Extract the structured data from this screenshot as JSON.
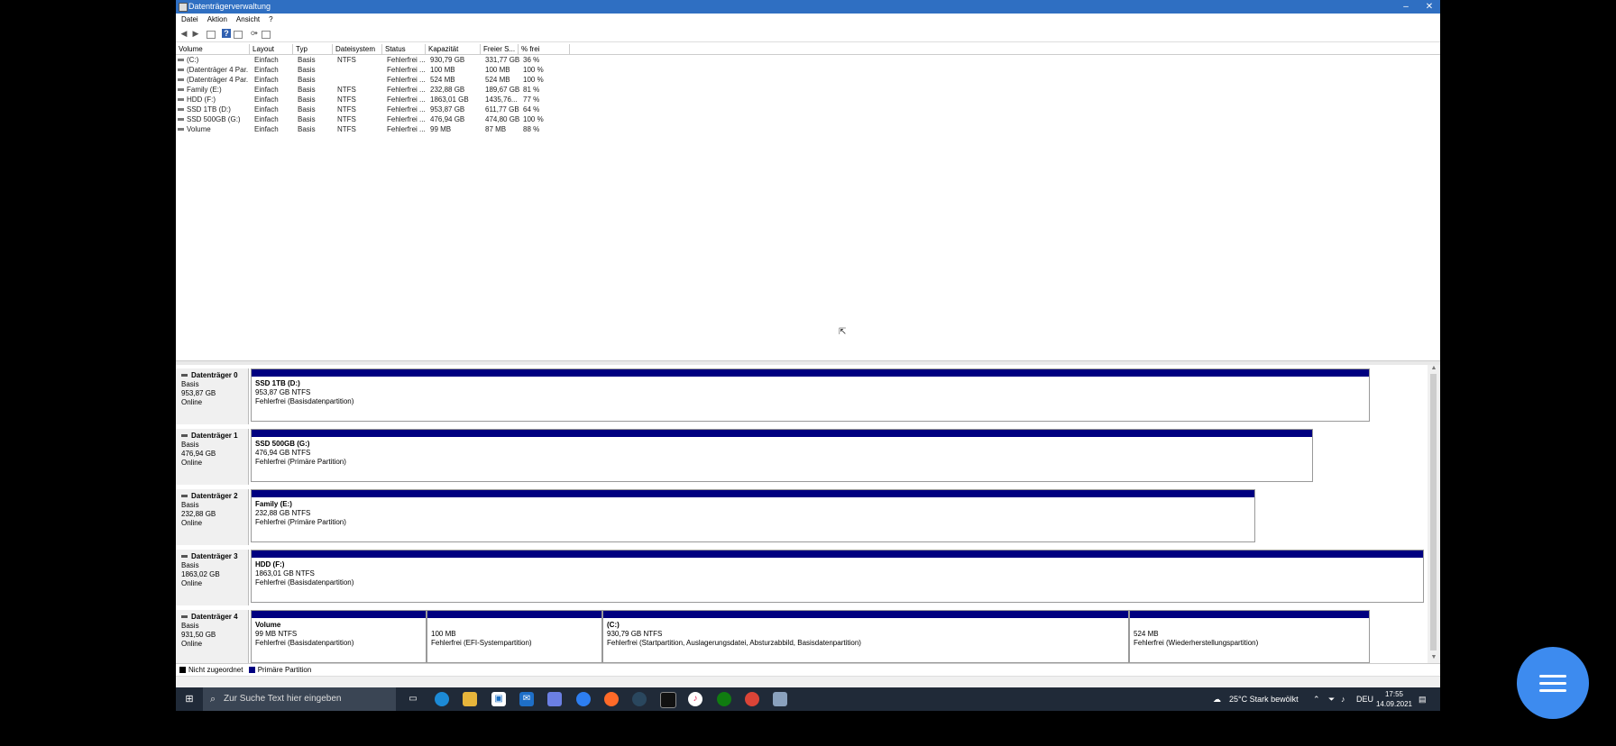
{
  "window": {
    "title": "Datenträgerverwaltung",
    "minimize": "–",
    "close": "✕"
  },
  "menu": [
    "Datei",
    "Aktion",
    "Ansicht",
    "?"
  ],
  "toolbar": {
    "back_icon": "back-arrow-icon",
    "forward_icon": "forward-arrow-icon",
    "help": "?"
  },
  "volumes": {
    "columns": [
      "Volume",
      "Layout",
      "Typ",
      "Dateisystem",
      "Status",
      "Kapazität",
      "Freier S...",
      "% frei"
    ],
    "rows": [
      [
        "(C:)",
        "Einfach",
        "Basis",
        "NTFS",
        "Fehlerfrei ...",
        "930,79 GB",
        "331,77 GB",
        "36 %"
      ],
      [
        "(Datenträger 4 Par...",
        "Einfach",
        "Basis",
        "",
        "Fehlerfrei ...",
        "100 MB",
        "100 MB",
        "100 %"
      ],
      [
        "(Datenträger 4 Par...",
        "Einfach",
        "Basis",
        "",
        "Fehlerfrei ...",
        "524 MB",
        "524 MB",
        "100 %"
      ],
      [
        "Family (E:)",
        "Einfach",
        "Basis",
        "NTFS",
        "Fehlerfrei ...",
        "232,88 GB",
        "189,67 GB",
        "81 %"
      ],
      [
        "HDD (F:)",
        "Einfach",
        "Basis",
        "NTFS",
        "Fehlerfrei ...",
        "1863,01 GB",
        "1435,76...",
        "77 %"
      ],
      [
        "SSD 1TB (D:)",
        "Einfach",
        "Basis",
        "NTFS",
        "Fehlerfrei ...",
        "953,87 GB",
        "611,77 GB",
        "64 %"
      ],
      [
        "SSD 500GB (G:)",
        "Einfach",
        "Basis",
        "NTFS",
        "Fehlerfrei ...",
        "476,94 GB",
        "474,80 GB",
        "100 %"
      ],
      [
        "Volume",
        "Einfach",
        "Basis",
        "NTFS",
        "Fehlerfrei ...",
        "99 MB",
        "87 MB",
        "88 %"
      ]
    ]
  },
  "disks": [
    {
      "name": "Datenträger 0",
      "type": "Basis",
      "size": "953,87 GB",
      "state": "Online",
      "partitions": [
        {
          "name": "SSD 1TB  (D:)",
          "size": "953,87 GB NTFS",
          "status": "Fehlerfrei (Basisdatenpartition)"
        }
      ]
    },
    {
      "name": "Datenträger 1",
      "type": "Basis",
      "size": "476,94 GB",
      "state": "Online",
      "partitions": [
        {
          "name": "SSD 500GB  (G:)",
          "size": "476,94 GB NTFS",
          "status": "Fehlerfrei (Primäre Partition)"
        }
      ]
    },
    {
      "name": "Datenträger 2",
      "type": "Basis",
      "size": "232,88 GB",
      "state": "Online",
      "partitions": [
        {
          "name": "Family  (E:)",
          "size": "232,88 GB NTFS",
          "status": "Fehlerfrei (Primäre Partition)"
        }
      ]
    },
    {
      "name": "Datenträger 3",
      "type": "Basis",
      "size": "1863,02 GB",
      "state": "Online",
      "partitions": [
        {
          "name": "HDD  (F:)",
          "size": "1863,01 GB NTFS",
          "status": "Fehlerfrei (Basisdatenpartition)"
        }
      ]
    },
    {
      "name": "Datenträger 4",
      "type": "Basis",
      "size": "931,50 GB",
      "state": "Online",
      "partitions": [
        {
          "name": "Volume",
          "size": "99 MB NTFS",
          "status": "Fehlerfrei (Basisdatenpartition)"
        },
        {
          "name": "",
          "size": "100 MB",
          "status": "Fehlerfrei (EFI-Systempartition)"
        },
        {
          "name": "(C:)",
          "size": "930,79 GB NTFS",
          "status": "Fehlerfrei (Startpartition, Auslagerungsdatei, Absturzabbild, Basisdatenpartition)"
        },
        {
          "name": "",
          "size": "524 MB",
          "status": "Fehlerfrei (Wiederherstellungspartition)"
        }
      ]
    }
  ],
  "legend": {
    "unallocated": "Nicht zugeordnet",
    "primary": "Primäre Partition",
    "unallocated_color": "#000000",
    "primary_color": "#000080"
  },
  "taskbar": {
    "search_placeholder": "Zur Suche Text hier eingeben",
    "weather": "25°C  Stark bewölkt",
    "language": "DEU",
    "time": "17:55",
    "date": "14.09.2021",
    "apps": [
      "task-view-icon",
      "edge-icon",
      "file-explorer-icon",
      "store-icon",
      "mail-icon",
      "game-controller-icon",
      "app-icon",
      "firefox-icon",
      "steam-icon",
      "epic-games-icon",
      "itunes-icon",
      "xbox-icon",
      "chrome-icon",
      "disk-management-icon"
    ]
  },
  "colors": {
    "titlebar": "#2f6fc2",
    "partition_bar": "#000080",
    "taskbar": "#202a38",
    "fab": "#3d8bef"
  }
}
